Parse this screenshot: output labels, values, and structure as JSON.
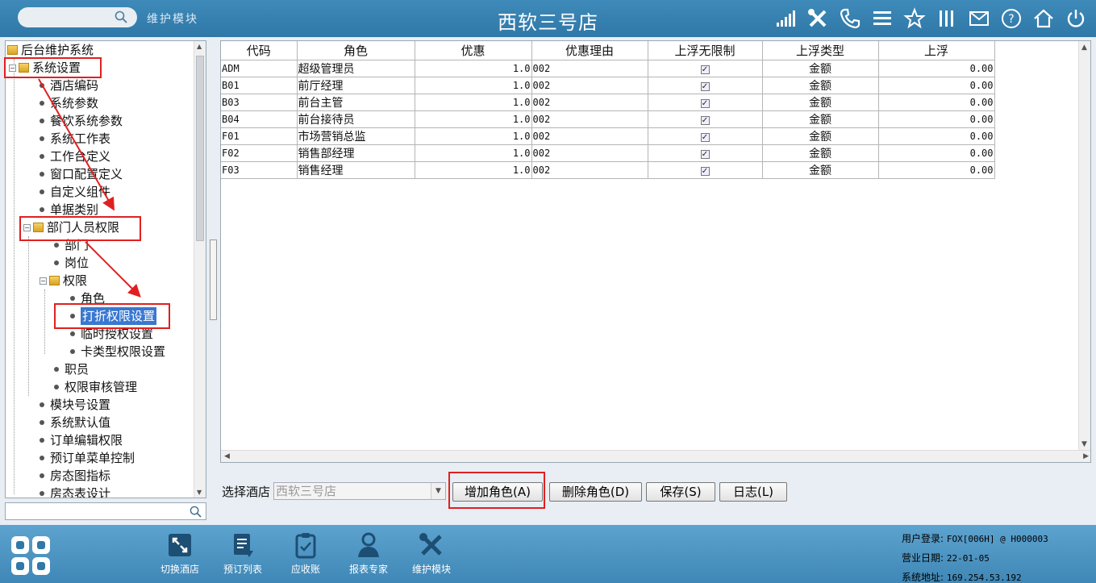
{
  "header": {
    "module_label": "维护模块",
    "title": "西软三号店"
  },
  "tree": {
    "items": [
      {
        "label": "后台维护系统"
      },
      {
        "label": "系统设置"
      },
      {
        "label": "酒店编码"
      },
      {
        "label": "系统参数"
      },
      {
        "label": "餐饮系统参数"
      },
      {
        "label": "系统工作表"
      },
      {
        "label": "工作台定义"
      },
      {
        "label": "窗口配置定义"
      },
      {
        "label": "自定义组件"
      },
      {
        "label": "单据类别"
      },
      {
        "label": "部门人员权限"
      },
      {
        "label": "部门"
      },
      {
        "label": "岗位"
      },
      {
        "label": "权限"
      },
      {
        "label": "角色"
      },
      {
        "label": "打折权限设置"
      },
      {
        "label": "临时授权设置"
      },
      {
        "label": "卡类型权限设置"
      },
      {
        "label": "职员"
      },
      {
        "label": "权限审核管理"
      },
      {
        "label": "模块号设置"
      },
      {
        "label": "系统默认值"
      },
      {
        "label": "订单编辑权限"
      },
      {
        "label": "预订单菜单控制"
      },
      {
        "label": "房态图指标"
      },
      {
        "label": "房态表设计"
      }
    ]
  },
  "grid": {
    "columns": [
      "代码",
      "角色",
      "优惠",
      "优惠理由",
      "上浮无限制",
      "上浮类型",
      "上浮"
    ],
    "rows": [
      {
        "code": "ADM",
        "role": "超级管理员",
        "discount": "1.0",
        "reason": "002",
        "unlimited": true,
        "float_type": "金额",
        "float": "0.00"
      },
      {
        "code": "B01",
        "role": "前厅经理",
        "discount": "1.0",
        "reason": "002",
        "unlimited": true,
        "float_type": "金额",
        "float": "0.00"
      },
      {
        "code": "B03",
        "role": "前台主管",
        "discount": "1.0",
        "reason": "002",
        "unlimited": true,
        "float_type": "金额",
        "float": "0.00"
      },
      {
        "code": "B04",
        "role": "前台接待员",
        "discount": "1.0",
        "reason": "002",
        "unlimited": true,
        "float_type": "金额",
        "float": "0.00"
      },
      {
        "code": "F01",
        "role": "市场营销总监",
        "discount": "1.0",
        "reason": "002",
        "unlimited": true,
        "float_type": "金额",
        "float": "0.00"
      },
      {
        "code": "F02",
        "role": "销售部经理",
        "discount": "1.0",
        "reason": "002",
        "unlimited": true,
        "float_type": "金额",
        "float": "0.00"
      },
      {
        "code": "F03",
        "role": "销售经理",
        "discount": "1.0",
        "reason": "002",
        "unlimited": true,
        "float_type": "金额",
        "float": "0.00"
      }
    ]
  },
  "controls": {
    "select_label": "选择酒店",
    "hotel_value": "西软三号店",
    "add_role": "增加角色(A)",
    "delete_role": "删除角色(D)",
    "save": "保存(S)",
    "log": "日志(L)"
  },
  "footer": {
    "buttons": [
      "切换酒店",
      "预订列表",
      "应收账",
      "报表专家",
      "维护模块"
    ],
    "status": {
      "login_label": "用户登录:",
      "login_value": "FOX[006H] @ H000003",
      "date_label": "营业日期:",
      "date_value": "22-01-05",
      "addr_label": "系统地址:",
      "addr_value": "169.254.53.192"
    }
  },
  "colors": {
    "header_bg": "#2f78a8",
    "footer_bg": "#3f87b6",
    "annotation": "#e02020",
    "selection": "#3a78d0"
  }
}
